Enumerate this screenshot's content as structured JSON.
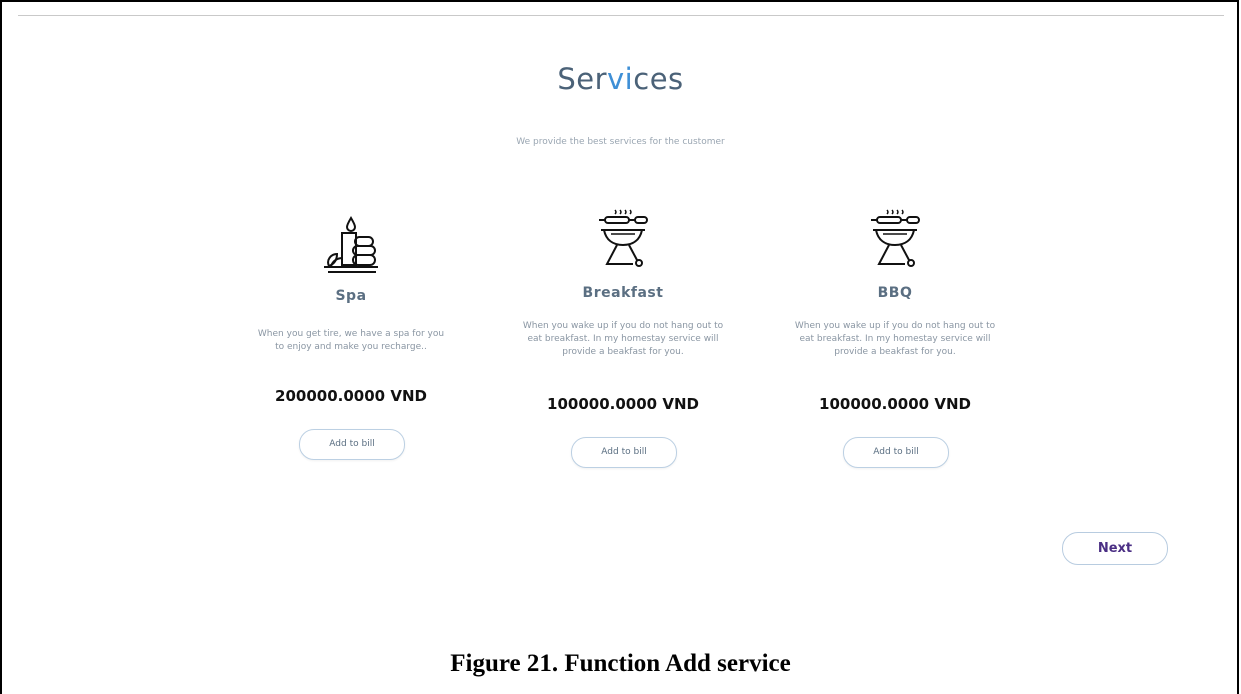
{
  "header": {
    "title_part1": "Ser",
    "title_accent": "vi",
    "title_part2": "ces",
    "subtitle": "We provide the best services for the customer"
  },
  "services": [
    {
      "icon": "spa-icon",
      "name": "Spa",
      "description": "When you get tire, we have a spa for you to enjoy and make you recharge..",
      "price": "200000.0000 VND",
      "button_label": "Add to bill"
    },
    {
      "icon": "barbecue-grill-icon",
      "name": "Breakfast",
      "description": "When you wake up if you do not hang out to eat breakfast. In my homestay service will provide a beakfast for you.",
      "price": "100000.0000 VND",
      "button_label": "Add to bill"
    },
    {
      "icon": "barbecue-grill-icon",
      "name": "BBQ",
      "description": "When you wake up if you do not hang out to eat breakfast. In my homestay service will provide a beakfast for you.",
      "price": "100000.0000 VND",
      "button_label": "Add to bill"
    }
  ],
  "footer": {
    "next_label": "Next",
    "caption": "Figure 21. Function Add service"
  },
  "colors": {
    "title": "#4b6278",
    "title_accent": "#3e8fd6",
    "next_text": "#4b2f84"
  }
}
